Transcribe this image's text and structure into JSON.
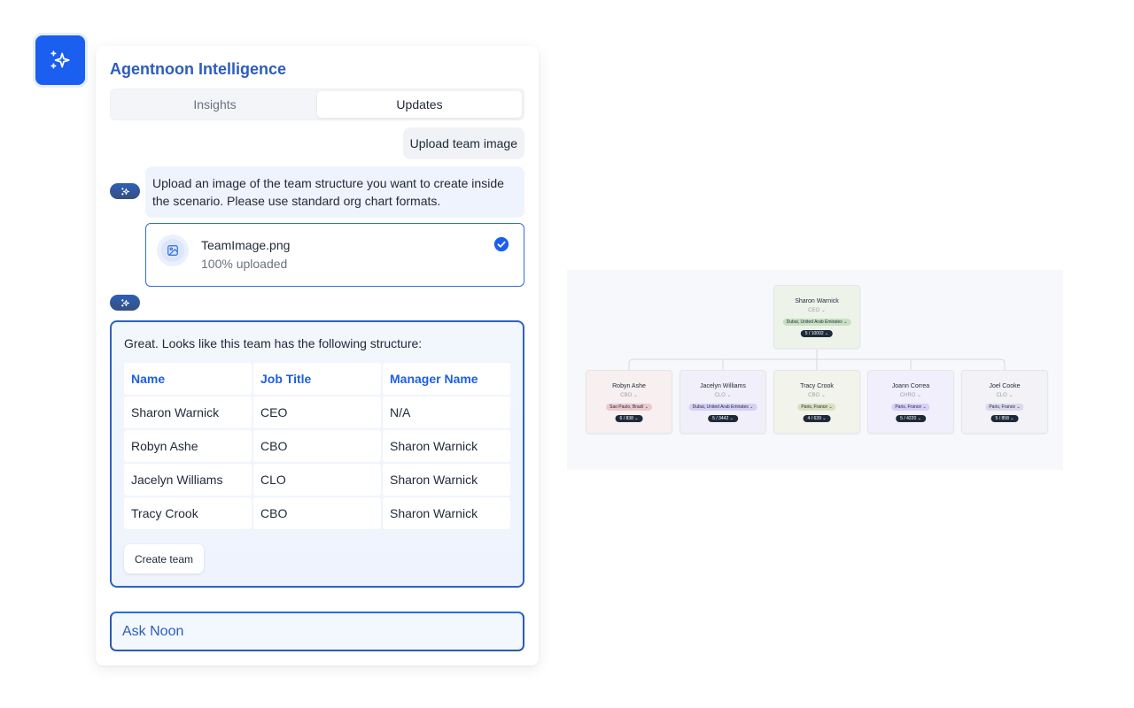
{
  "launcher": {
    "icon": "sparkles-icon"
  },
  "panel": {
    "title": "Agentnoon Intelligence",
    "tabs": [
      {
        "label": "Insights",
        "active": false
      },
      {
        "label": "Updates",
        "active": true
      }
    ],
    "user_message": "Upload team image",
    "ai_message": "Upload an image of the team structure you want to create inside the scenario. Please use standard org chart formats.",
    "upload": {
      "file_name": "TeamImage.png",
      "status": "100% uploaded",
      "icon": "image-icon",
      "status_icon": "check-circle-icon"
    },
    "result": {
      "intro": "Great. Looks like this team has the following structure:",
      "columns": [
        "Name",
        "Job Title",
        "Manager Name"
      ],
      "rows": [
        [
          "Sharon Warnick",
          "CEO",
          "N/A"
        ],
        [
          "Robyn Ashe",
          "CBO",
          "Sharon Warnick"
        ],
        [
          "Jacelyn Williams",
          "CLO",
          "Sharon Warnick"
        ],
        [
          "Tracy Crook",
          "CBO",
          "Sharon Warnick"
        ]
      ],
      "create_button": "Create team"
    },
    "ask_placeholder": "Ask Noon"
  },
  "org_chart": {
    "root": {
      "name": "Sharon Warnick",
      "role": "CEO",
      "location": "Dubai, United Arab Emirates",
      "count": "5 / 10002",
      "bg": "#eef3ea",
      "loc_bg": "#c9dfc2"
    },
    "children": [
      {
        "name": "Robyn Ashe",
        "role": "CBO",
        "location": "Sao Paulo, Brazil",
        "count": "6 / 838",
        "bg": "#f8eff0",
        "loc_bg": "#ecc9cd"
      },
      {
        "name": "Jacelyn Williams",
        "role": "CLO",
        "location": "Dubai, United Arab Emirates",
        "count": "5 / 3442",
        "bg": "#f1effa",
        "loc_bg": "#d6cff5"
      },
      {
        "name": "Tracy Crook",
        "role": "CBO",
        "location": "Paris, France",
        "count": "4 / 639",
        "bg": "#f2f3ea",
        "loc_bg": "#d9e0bf"
      },
      {
        "name": "Joann Correa",
        "role": "CHRO",
        "location": "Paris, France",
        "count": "5 / 4220",
        "bg": "#f1effb",
        "loc_bg": "#d8cffa"
      },
      {
        "name": "Joel Cooke",
        "role": "CLO",
        "location": "Paris, France",
        "count": "5 / 858",
        "bg": "#f3f2f7",
        "loc_bg": "#dcd8ec"
      }
    ]
  }
}
